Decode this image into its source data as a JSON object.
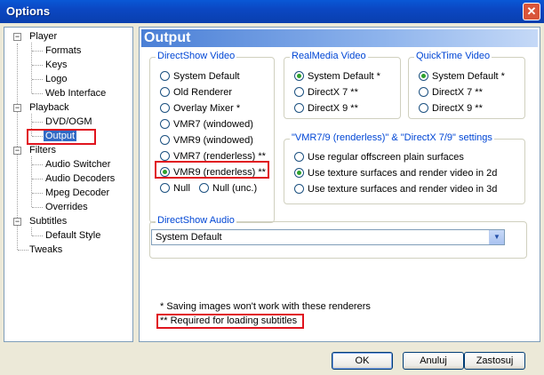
{
  "window": {
    "title": "Options",
    "close_glyph": "✕"
  },
  "tree": {
    "items": [
      {
        "label": "Player",
        "expander": "−"
      },
      {
        "label": "Formats"
      },
      {
        "label": "Keys"
      },
      {
        "label": "Logo"
      },
      {
        "label": "Web Interface"
      },
      {
        "label": "Playback",
        "expander": "−"
      },
      {
        "label": "DVD/OGM"
      },
      {
        "label": "Output",
        "selected": true
      },
      {
        "label": "Filters",
        "expander": "−"
      },
      {
        "label": "Audio Switcher"
      },
      {
        "label": "Audio Decoders"
      },
      {
        "label": "Mpeg Decoder"
      },
      {
        "label": "Overrides"
      },
      {
        "label": "Subtitles",
        "expander": "−"
      },
      {
        "label": "Default Style"
      },
      {
        "label": "Tweaks"
      }
    ]
  },
  "panel": {
    "title": "Output"
  },
  "directshow_video": {
    "title": "DirectShow Video",
    "options": [
      "System Default",
      "Old Renderer",
      "Overlay Mixer *",
      "VMR7 (windowed)",
      "VMR9 (windowed)",
      "VMR7 (renderless) **",
      "VMR9 (renderless) **",
      "Null",
      "Null (unc.)"
    ],
    "selected": "VMR9 (renderless) **"
  },
  "realmedia_video": {
    "title": "RealMedia Video",
    "options": [
      "System Default *",
      "DirectX 7 **",
      "DirectX 9 **"
    ],
    "selected": "System Default *"
  },
  "quicktime_video": {
    "title": "QuickTime Video",
    "options": [
      "System Default *",
      "DirectX 7 **",
      "DirectX 9 **"
    ],
    "selected": "System Default *"
  },
  "vmr_settings": {
    "title": "\"VMR7/9 (renderless)\" & \"DirectX 7/9\" settings",
    "options": [
      "Use regular offscreen plain surfaces",
      "Use texture surfaces and render video in 2d",
      "Use texture surfaces and render video in 3d"
    ],
    "selected": "Use texture surfaces and render video in 2d"
  },
  "directshow_audio": {
    "title": "DirectShow Audio",
    "value": "System Default",
    "arrow_glyph": "▼"
  },
  "notes": {
    "note1": "* Saving images won't work with these renderers",
    "note2": "** Required for loading subtitles"
  },
  "buttons": {
    "ok": "OK",
    "cancel": "Anuluj",
    "apply": "Zastosuj"
  },
  "colors": {
    "titlebar": "#0a58d6",
    "accent": "#316ac5",
    "highlight": "#e0141e",
    "radio_on": "#2ca02c"
  }
}
